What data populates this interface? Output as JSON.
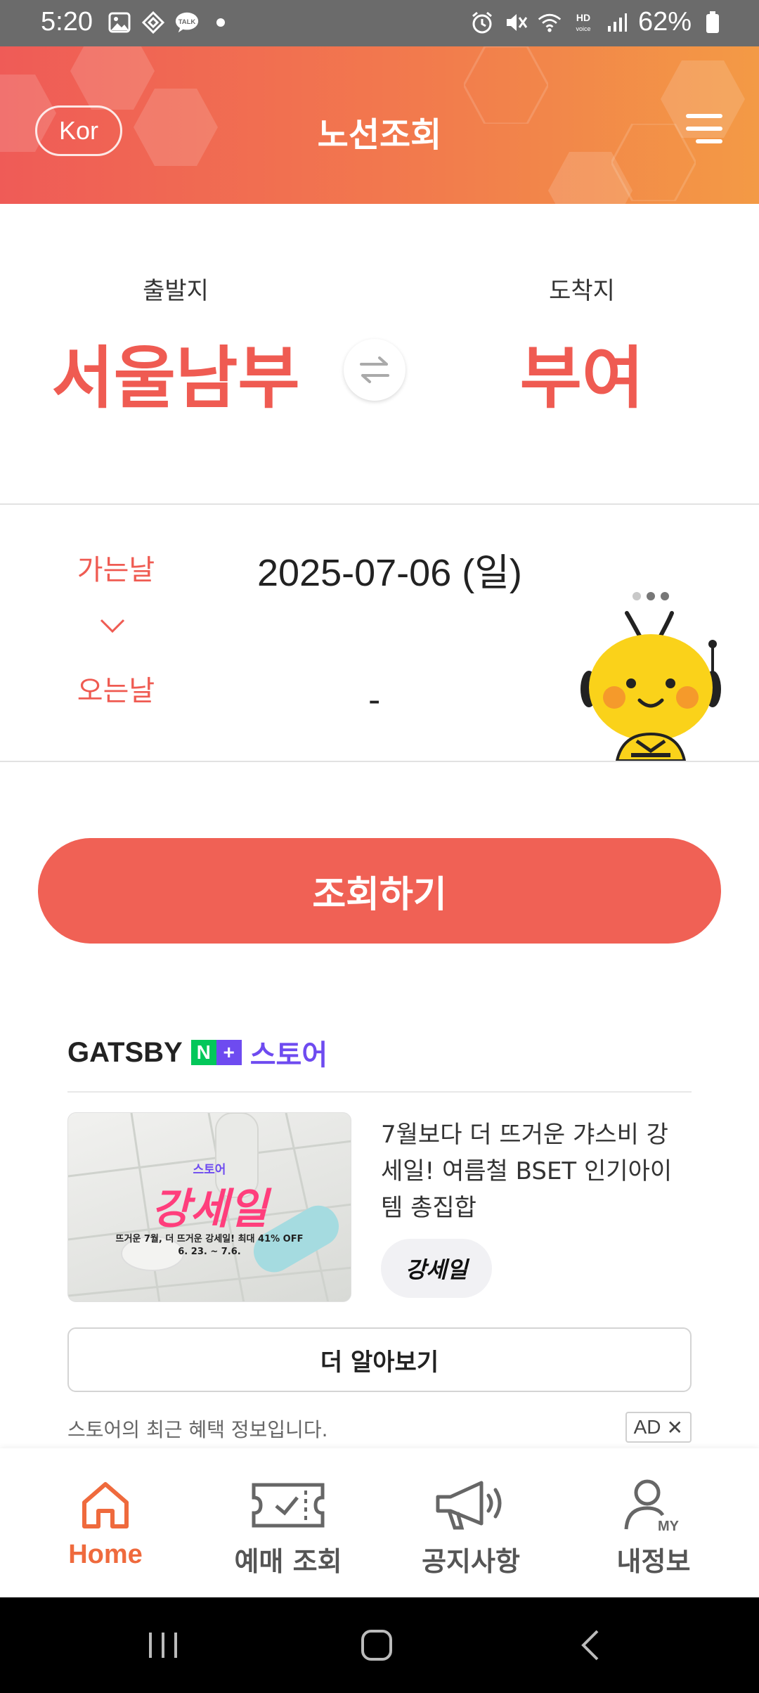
{
  "status_bar": {
    "time": "5:20",
    "left_icons": [
      "gallery-icon",
      "app-icon",
      "talk-icon",
      "dot-icon"
    ],
    "talk_label": "TALK",
    "right_icons": [
      "alarm-icon",
      "mute-icon",
      "wifi-icon",
      "hd-voice-icon",
      "signal-icon",
      "battery-icon"
    ],
    "battery": "62%"
  },
  "header": {
    "lang_button": "Kor",
    "title": "노선조회",
    "menu_icon": "menu-icon",
    "colors": {
      "start": "#ef5b57",
      "end": "#f39a45"
    }
  },
  "route": {
    "departure_label": "출발지",
    "departure_city": "서울남부",
    "arrival_label": "도착지",
    "arrival_city": "부여",
    "swap_icon": "swap-icon",
    "accent": "#ef5b52"
  },
  "dates": {
    "go_label": "가는날",
    "go_date": "2025-07-06 (일)",
    "return_label": "오는날",
    "return_date": "-"
  },
  "search_button": "조회하기",
  "ad": {
    "brand": "GATSBY",
    "npay_n": "N",
    "npay_plus": "+",
    "store": "스토어",
    "image": {
      "brand_small": "스토어",
      "headline": "강세일",
      "line1": "뜨거운 7월, 더 뜨거운 강세일! 최대 41% OFF",
      "line2": "6. 23. ~ 7.6."
    },
    "description": "7월보다 더 뜨거운 갸스비 강세일! 여름철 BSET 인기아이템 총집합",
    "tag": "강세일",
    "more_button": "더 알아보기",
    "note": "스토어의 최근 혜택 정보입니다.",
    "badge": "AD",
    "close": "✕"
  },
  "bottom_nav": {
    "items": [
      {
        "label": "Home",
        "icon": "home-icon",
        "active": true
      },
      {
        "label": "예매 조회",
        "icon": "ticket-icon",
        "active": false
      },
      {
        "label": "공지사항",
        "icon": "megaphone-icon",
        "active": false
      },
      {
        "label": "내정보",
        "icon": "my-profile-icon",
        "active": false
      }
    ],
    "active_color": "#ef6a3d"
  }
}
